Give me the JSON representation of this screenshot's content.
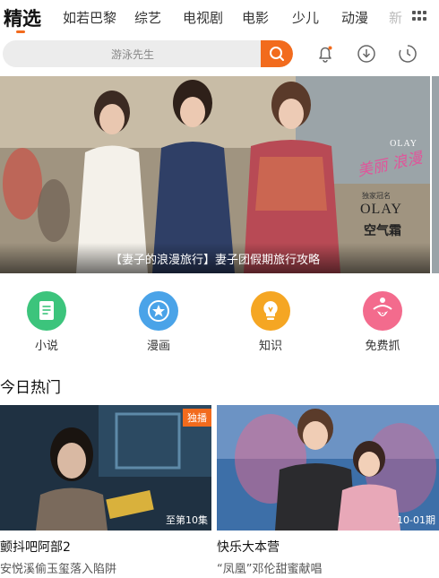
{
  "nav": {
    "tabs": [
      {
        "label": "精选",
        "active": true
      },
      {
        "label": "如若巴黎",
        "active": false
      },
      {
        "label": "综艺",
        "active": false
      },
      {
        "label": "电视剧",
        "active": false
      },
      {
        "label": "电影",
        "active": false
      },
      {
        "label": "少儿",
        "active": false
      },
      {
        "label": "动漫",
        "active": false
      },
      {
        "label": "新",
        "active": false
      }
    ],
    "menu_icon": "grid-icon"
  },
  "search": {
    "placeholder": "游泳先生",
    "button_icon": "search-icon"
  },
  "header_icons": [
    "bell-icon",
    "download-icon",
    "history-icon"
  ],
  "banner": {
    "caption": "【妻子的浪漫旅行】妻子团假期旅行攻略",
    "ad": {
      "brand_top": "OLAY",
      "script": "美丽 浪漫",
      "sponsor": "独家冠名",
      "brand": "OLAY",
      "product": "空气霜"
    }
  },
  "categories": [
    {
      "label": "小说",
      "icon": "book-icon",
      "color": "#3cc47c"
    },
    {
      "label": "漫画",
      "icon": "star-badge-icon",
      "color": "#4aa3e8"
    },
    {
      "label": "知识",
      "icon": "lightbulb-icon",
      "color": "#f5a623"
    },
    {
      "label": "免费抓",
      "icon": "claw-icon",
      "color": "#f36b8d"
    }
  ],
  "section": {
    "title": "今日热门"
  },
  "cards": [
    {
      "title": "颤抖吧阿部2",
      "subtitle": "安悦溪偷玉玺落入陷阱",
      "badge": "独播",
      "episode": "至第10集"
    },
    {
      "title": "快乐大本营",
      "subtitle": "“凤凰”邓伦甜蜜献唱",
      "badge": "",
      "episode": "10-01期"
    }
  ],
  "colors": {
    "accent": "#f26b1d"
  }
}
